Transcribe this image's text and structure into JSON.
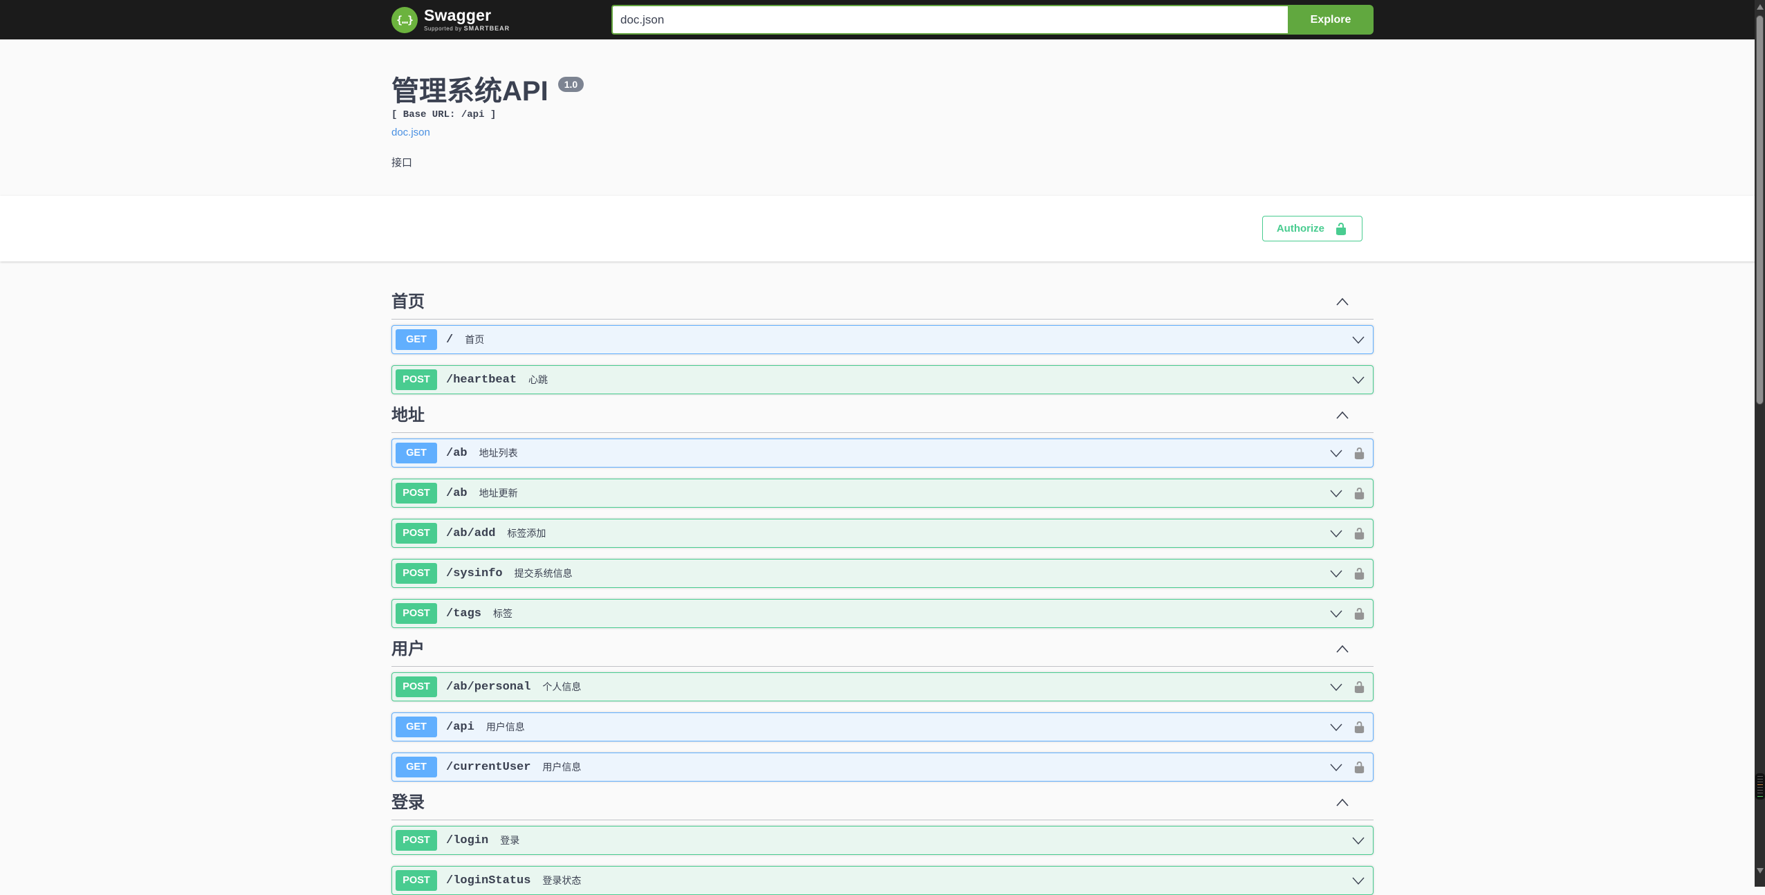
{
  "topbar": {
    "brand": "Swagger",
    "brand_sub_prefix": "Supported by ",
    "brand_sub_name": "SMARTBEAR",
    "logo_glyph": "{…}",
    "search_value": "doc.json",
    "explore_label": "Explore"
  },
  "info": {
    "title": "管理系统API",
    "version": "1.0",
    "base_url_label": "[ Base URL: /api ]",
    "spec_link": "doc.json",
    "description": "接口"
  },
  "auth": {
    "authorize_label": "Authorize"
  },
  "colors": {
    "topbar_bg": "#1b1b1b",
    "explore_green": "#61a83f",
    "input_border_green": "#62a33d",
    "get_blue": "#61affe",
    "post_green": "#49cc90",
    "authorize_green": "#49cc90",
    "link_blue": "#4990e2",
    "version_badge_bg": "#7d8492",
    "text_dark": "#3b4151"
  },
  "sections": [
    {
      "name": "首页",
      "operations": [
        {
          "method": "GET",
          "path": "/",
          "summary": "首页"
        },
        {
          "method": "POST",
          "path": "/heartbeat",
          "summary": "心跳"
        }
      ]
    },
    {
      "name": "地址",
      "operations": [
        {
          "method": "GET",
          "path": "/ab",
          "summary": "地址列表"
        },
        {
          "method": "POST",
          "path": "/ab",
          "summary": "地址更新"
        },
        {
          "method": "POST",
          "path": "/ab/add",
          "summary": "标签添加"
        },
        {
          "method": "POST",
          "path": "/sysinfo",
          "summary": "提交系统信息"
        },
        {
          "method": "POST",
          "path": "/tags",
          "summary": "标签"
        }
      ]
    },
    {
      "name": "用户",
      "operations": [
        {
          "method": "POST",
          "path": "/ab/personal",
          "summary": "个人信息"
        },
        {
          "method": "GET",
          "path": "/api",
          "summary": "用户信息"
        },
        {
          "method": "GET",
          "path": "/currentUser",
          "summary": "用户信息"
        }
      ]
    },
    {
      "name": "登录",
      "operations": [
        {
          "method": "POST",
          "path": "/login",
          "summary": "登录"
        },
        {
          "method": "POST",
          "path": "/loginStatus",
          "summary": "登录状态"
        }
      ]
    }
  ]
}
